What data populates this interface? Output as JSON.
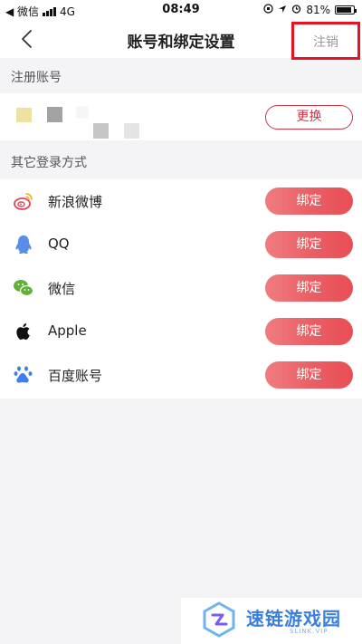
{
  "status_bar": {
    "carrier_back": "◀ 微信",
    "network": "4G",
    "time": "08:49",
    "battery": "81%"
  },
  "nav": {
    "title": "账号和绑定设置",
    "cancel_label": "注销"
  },
  "registered_account": {
    "section_label": "注册账号",
    "change_label": "更换"
  },
  "other_logins": {
    "section_label": "其它登录方式",
    "items": [
      {
        "name": "新浪微博",
        "icon": "weibo-icon",
        "action": "绑定"
      },
      {
        "name": "QQ",
        "icon": "qq-icon",
        "action": "绑定"
      },
      {
        "name": "微信",
        "icon": "wechat-icon",
        "action": "绑定"
      },
      {
        "name": "Apple",
        "icon": "apple-icon",
        "action": "绑定"
      },
      {
        "name": "百度账号",
        "icon": "baidu-icon",
        "action": "绑定"
      }
    ]
  },
  "watermark": {
    "text": "速链游戏园",
    "sub": "SLINK.VIP"
  },
  "colors": {
    "accent": "#e84f56",
    "highlight_box": "#e8131e"
  }
}
